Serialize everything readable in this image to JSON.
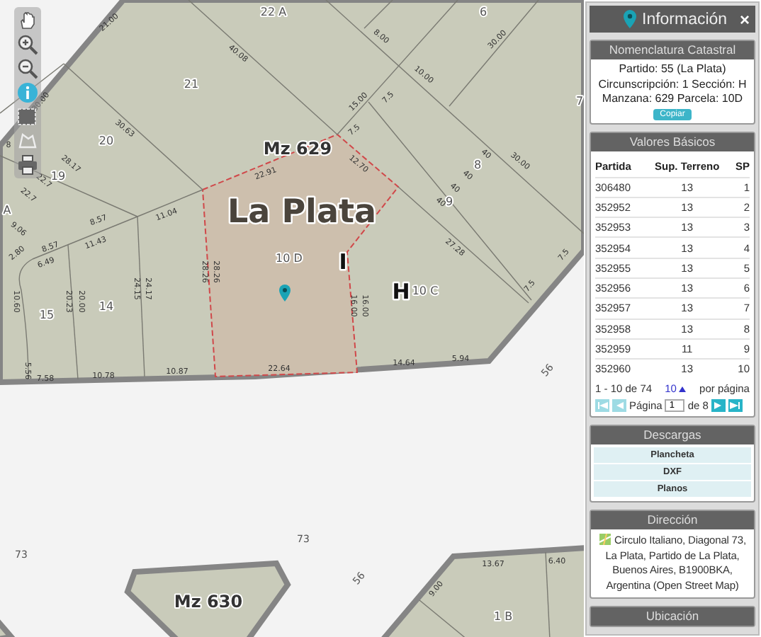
{
  "toolbar": {
    "tools": [
      {
        "kind": "pan"
      },
      {
        "kind": "zoom_in"
      },
      {
        "kind": "zoom_out"
      },
      {
        "kind": "info"
      },
      {
        "kind": "select"
      },
      {
        "kind": "measure"
      },
      {
        "kind": "print"
      }
    ]
  },
  "map": {
    "labels": [
      {
        "text": "22 A",
        "kind": "lot"
      },
      {
        "text": "6",
        "kind": "lot"
      },
      {
        "text": "21",
        "kind": "lot"
      },
      {
        "text": "20",
        "kind": "lot"
      },
      {
        "text": "19",
        "kind": "lot"
      },
      {
        "text": "Mz 629",
        "kind": "block"
      },
      {
        "text": "La Plata",
        "kind": "city"
      },
      {
        "text": "10 D",
        "kind": "lot"
      },
      {
        "text": "I",
        "kind": "letter"
      },
      {
        "text": "H",
        "kind": "letter"
      },
      {
        "text": "10 C",
        "kind": "lot"
      },
      {
        "text": "9",
        "kind": "lot"
      },
      {
        "text": "8",
        "kind": "lot"
      },
      {
        "text": "14",
        "kind": "lot"
      },
      {
        "text": "15",
        "kind": "lot"
      },
      {
        "text": "A",
        "kind": "lot"
      },
      {
        "text": "7",
        "kind": "lot"
      },
      {
        "text": "73",
        "kind": "street"
      },
      {
        "text": "73",
        "kind": "street"
      },
      {
        "text": "56",
        "kind": "street"
      },
      {
        "text": "56",
        "kind": "street"
      },
      {
        "text": "Mz 630",
        "kind": "block"
      },
      {
        "text": "1 B",
        "kind": "lot"
      },
      {
        "text": "21.00",
        "kind": "measure"
      },
      {
        "text": "40.08",
        "kind": "measure"
      },
      {
        "text": "30.00",
        "kind": "measure"
      },
      {
        "text": "30.63",
        "kind": "measure"
      },
      {
        "text": "28.17",
        "kind": "measure"
      },
      {
        "text": "22.7",
        "kind": "measure"
      },
      {
        "text": "22.7",
        "kind": "measure"
      },
      {
        "text": "8",
        "kind": "measure"
      },
      {
        "text": "9.06",
        "kind": "measure"
      },
      {
        "text": "2.80",
        "kind": "measure"
      },
      {
        "text": "10.60",
        "kind": "measure"
      },
      {
        "text": "8.57",
        "kind": "measure"
      },
      {
        "text": "8.57",
        "kind": "measure"
      },
      {
        "text": "6.49",
        "kind": "measure"
      },
      {
        "text": "11.43",
        "kind": "measure"
      },
      {
        "text": "11.04",
        "kind": "measure"
      },
      {
        "text": "22.91",
        "kind": "measure"
      },
      {
        "text": "28.26",
        "kind": "measure"
      },
      {
        "text": "28.26",
        "kind": "measure"
      },
      {
        "text": "20.23",
        "kind": "measure"
      },
      {
        "text": "20.00",
        "kind": "measure"
      },
      {
        "text": "24.15",
        "kind": "measure"
      },
      {
        "text": "24.17",
        "kind": "measure"
      },
      {
        "text": "5.56",
        "kind": "measure"
      },
      {
        "text": "7.58",
        "kind": "measure"
      },
      {
        "text": "10.78",
        "kind": "measure"
      },
      {
        "text": "10.87",
        "kind": "measure"
      },
      {
        "text": "22.64",
        "kind": "measure"
      },
      {
        "text": "14.64",
        "kind": "measure"
      },
      {
        "text": "5.94",
        "kind": "measure"
      },
      {
        "text": "16.00",
        "kind": "measure"
      },
      {
        "text": "16.00",
        "kind": "measure"
      },
      {
        "text": "12.70",
        "kind": "measure"
      },
      {
        "text": "7.5",
        "kind": "measure"
      },
      {
        "text": "15.00",
        "kind": "measure"
      },
      {
        "text": "7.5",
        "kind": "measure"
      },
      {
        "text": "8.00",
        "kind": "measure"
      },
      {
        "text": "10.00",
        "kind": "measure"
      },
      {
        "text": "30.00",
        "kind": "measure"
      },
      {
        "text": "40",
        "kind": "measure"
      },
      {
        "text": "30.00",
        "kind": "measure"
      },
      {
        "text": "40",
        "kind": "measure"
      },
      {
        "text": "40",
        "kind": "measure"
      },
      {
        "text": "40",
        "kind": "measure"
      },
      {
        "text": "27.28",
        "kind": "measure"
      },
      {
        "text": "7.5",
        "kind": "measure"
      },
      {
        "text": "7.5",
        "kind": "measure"
      },
      {
        "text": "13.67",
        "kind": "measure"
      },
      {
        "text": "6.40",
        "kind": "measure"
      },
      {
        "text": "9.00",
        "kind": "measure"
      }
    ]
  },
  "panel": {
    "title": "Información",
    "close": "×",
    "cadastral": {
      "title": "Nomenclatura Catastral",
      "lines": [
        "Partido: 55 (La Plata)",
        "Circunscripción: 1 Sección: H",
        "Manzana: 629 Parcela: 10D"
      ],
      "copy_button": "Copiar"
    },
    "values": {
      "title": "Valores Básicos",
      "columns": [
        "Partida",
        "Sup. Terreno",
        "SP"
      ],
      "rows": [
        [
          "306480",
          "13",
          "1"
        ],
        [
          "352952",
          "13",
          "2"
        ],
        [
          "352953",
          "13",
          "3"
        ],
        [
          "352954",
          "13",
          "4"
        ],
        [
          "352955",
          "13",
          "5"
        ],
        [
          "352956",
          "13",
          "6"
        ],
        [
          "352957",
          "13",
          "7"
        ],
        [
          "352958",
          "13",
          "8"
        ],
        [
          "352959",
          "11",
          "9"
        ],
        [
          "352960",
          "13",
          "10"
        ]
      ],
      "range": "1 - 10 de 74",
      "page_size": "10",
      "per_page": "por página",
      "page_label": "Página",
      "page_value": "1",
      "page_total": "de 8",
      "pager_buttons": [
        {
          "kind": "first",
          "disabled": true
        },
        {
          "kind": "prev",
          "disabled": true
        },
        {
          "kind": "next",
          "disabled": false
        },
        {
          "kind": "last",
          "disabled": false
        }
      ]
    },
    "downloads": {
      "title": "Descargas",
      "links": [
        "Plancheta",
        "DXF",
        "Planos"
      ]
    },
    "address": {
      "title": "Dirección",
      "text": "Circulo Italiano, Diagonal 73, La Plata, Partido de La Plata, Buenos Aires, B1900BKA, Argentina (Open Street Map)"
    },
    "location": {
      "title": "Ubicación"
    }
  }
}
